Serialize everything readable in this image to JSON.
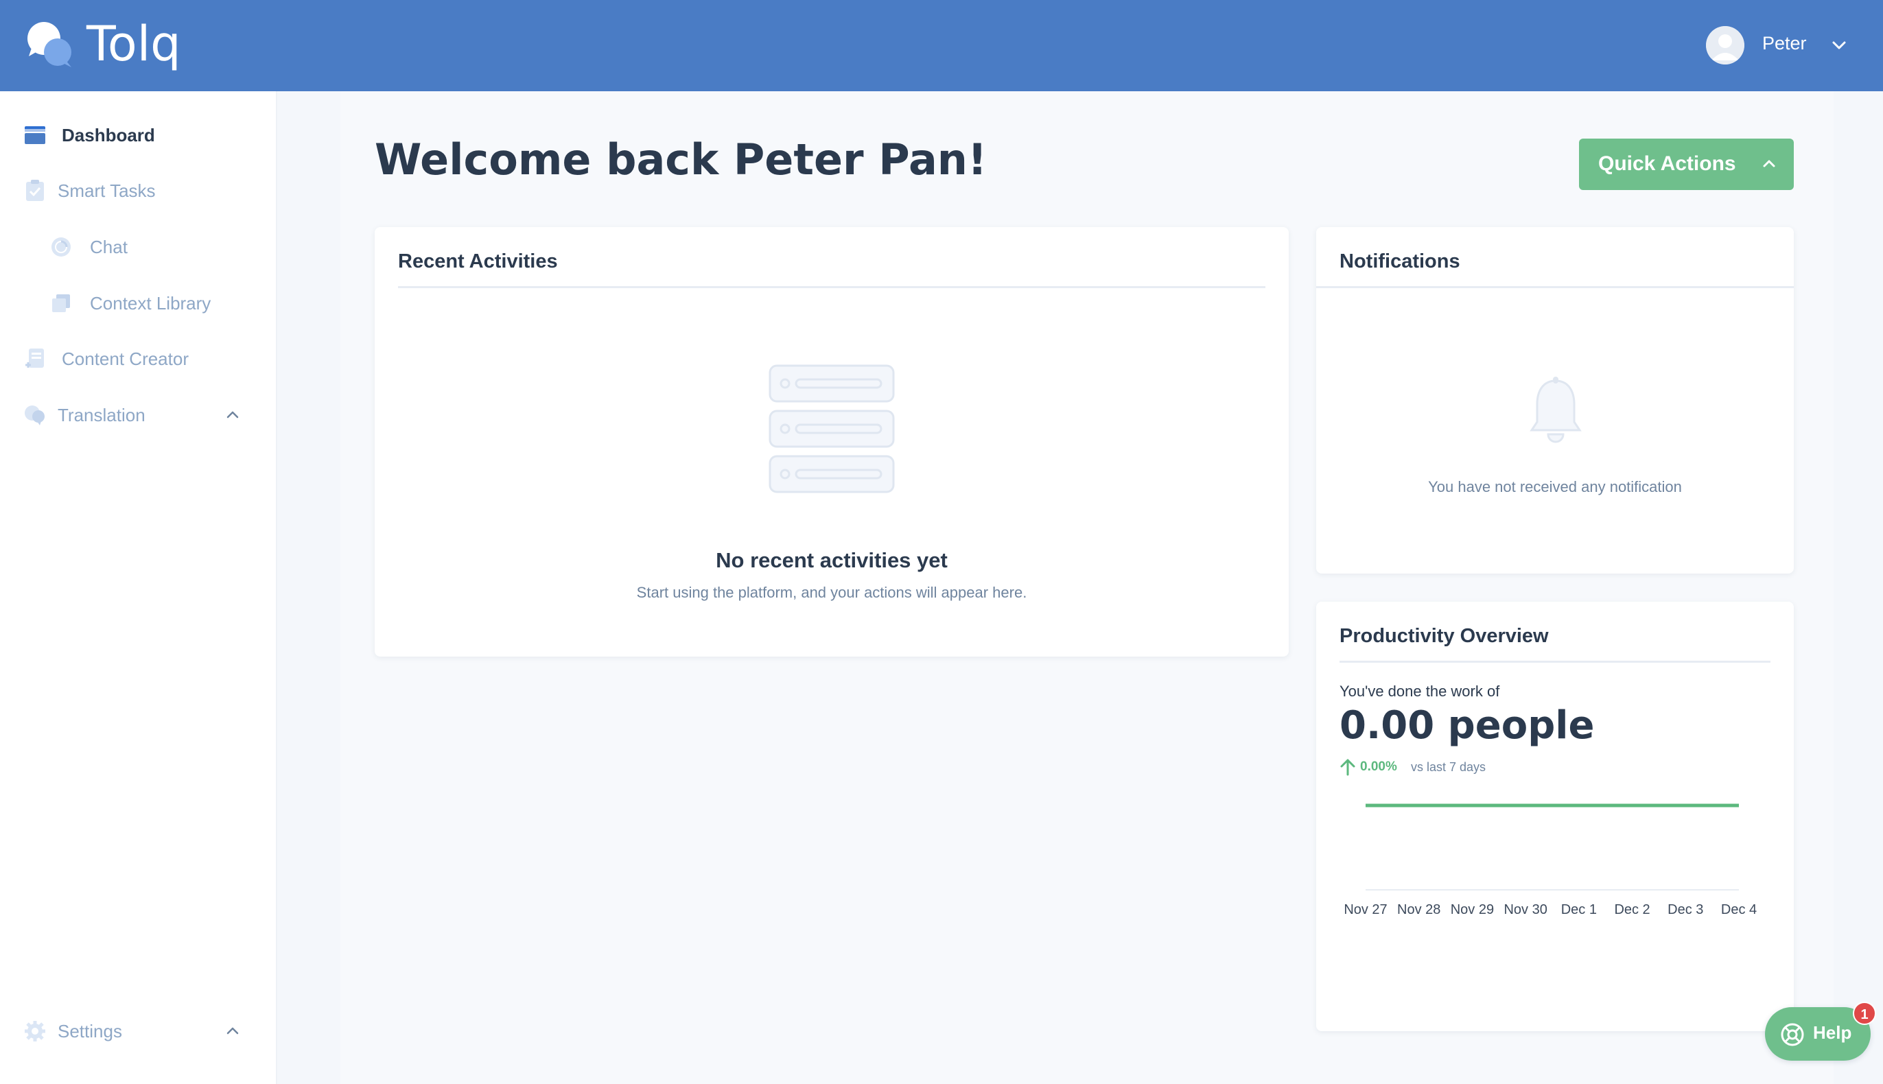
{
  "app": {
    "name": "Tolq"
  },
  "header": {
    "user_name": "Peter",
    "icons": [
      "tolq-logo-icon",
      "avatar",
      "chevron-down-icon"
    ]
  },
  "sidebar": {
    "items": [
      {
        "label": "Dashboard",
        "icon": "dashboard-icon",
        "active": true
      },
      {
        "label": "Smart Tasks",
        "icon": "smart-tasks-icon"
      },
      {
        "label": "Chat",
        "icon": "chat-icon"
      },
      {
        "label": "Context Library",
        "icon": "context-library-icon"
      },
      {
        "label": "Content Creator",
        "icon": "content-creator-icon"
      },
      {
        "label": "Translation",
        "icon": "translation-icon",
        "expanded": true
      }
    ],
    "settings": {
      "label": "Settings",
      "icon": "gear-icon",
      "expanded": true
    }
  },
  "main": {
    "welcome": "Welcome back Peter Pan!",
    "quick_actions": "Quick Actions"
  },
  "recent_activities": {
    "title": "Recent Activities",
    "empty_title": "No recent activities yet",
    "empty_sub": "Start using the platform, and your actions will appear here."
  },
  "notifications": {
    "title": "Notifications",
    "empty_text": "You have not received any notification"
  },
  "productivity": {
    "title": "Productivity Overview",
    "lead": "You've done the work of",
    "big_value": "0.00 people",
    "delta": "0.00%",
    "delta_suffix": "vs last 7 days"
  },
  "chart_data": {
    "type": "line",
    "categories": [
      "Nov 27",
      "Nov 28",
      "Nov 29",
      "Nov 30",
      "Dec 1",
      "Dec 2",
      "Dec 3",
      "Dec 4"
    ],
    "series": [
      {
        "values": [
          0,
          0,
          0,
          0,
          0,
          0,
          0,
          0
        ]
      }
    ],
    "grid": false,
    "line_color": "#5cb87e"
  },
  "help": {
    "label": "Help",
    "badge": "1"
  },
  "colors": {
    "header": "#4a7cc5",
    "accent_green": "#6fbf8c",
    "text_dark": "#2b3a4e",
    "text_muted": "#8ea7c6",
    "badge_red": "#e04848"
  }
}
